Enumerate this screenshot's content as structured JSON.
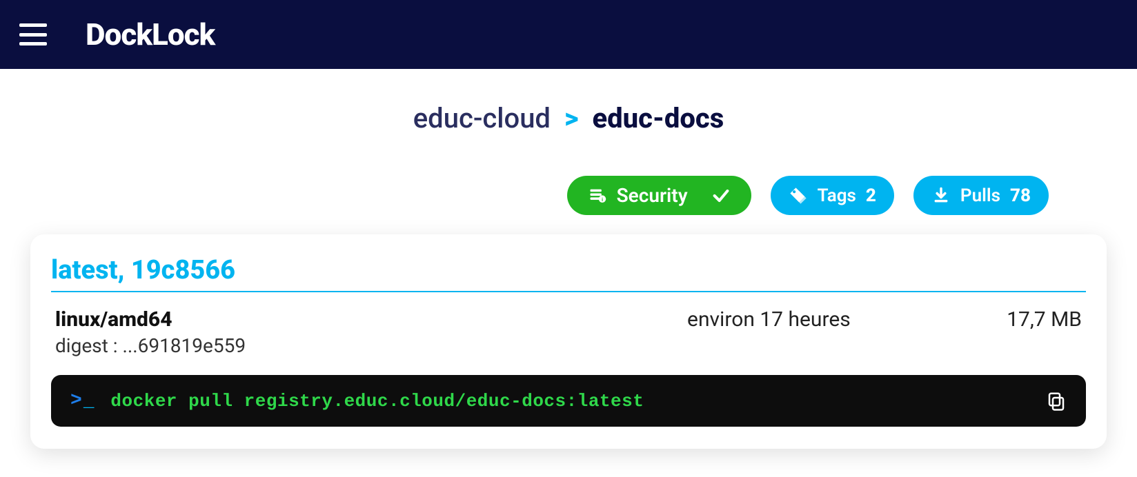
{
  "header": {
    "brand": "DockLock"
  },
  "breadcrumb": {
    "parent": "educ-cloud",
    "separator": ">",
    "current": "educ-docs"
  },
  "actions": {
    "security": {
      "label": "Security"
    },
    "tags": {
      "label": "Tags",
      "count": "2"
    },
    "pulls": {
      "label": "Pulls",
      "count": "78"
    }
  },
  "card": {
    "title": "latest, 19c8566",
    "platform": "linux/amd64",
    "digest_label": "digest : ...691819e559",
    "age": "environ 17 heures",
    "size": "17,7 MB",
    "command": "docker pull registry.educ.cloud/educ-docs:latest"
  }
}
